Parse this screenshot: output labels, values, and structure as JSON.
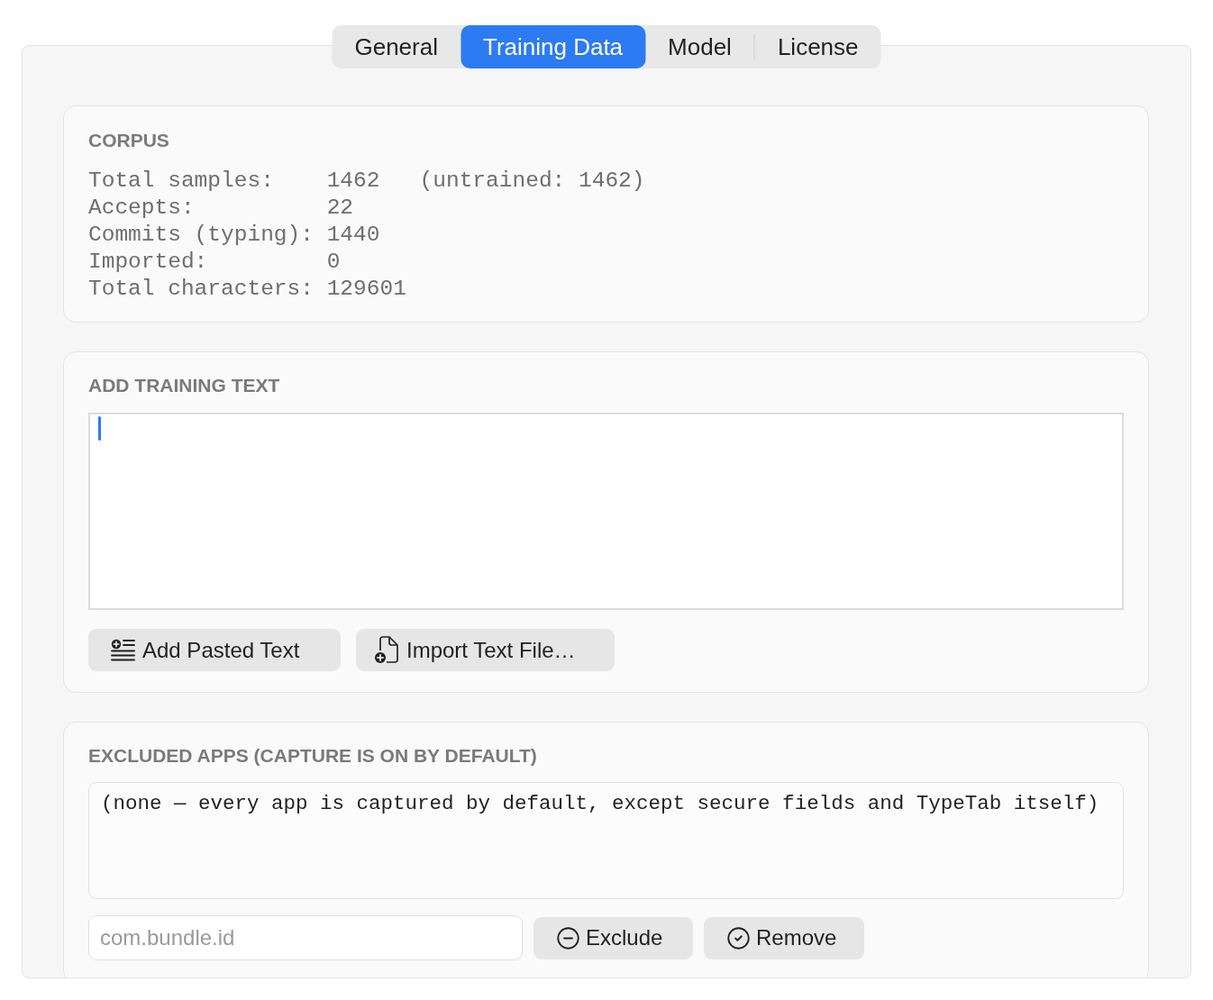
{
  "tabs": [
    {
      "label": "General",
      "selected": false
    },
    {
      "label": "Training Data",
      "selected": true
    },
    {
      "label": "Model",
      "selected": false
    },
    {
      "label": "License",
      "selected": false
    }
  ],
  "corpus": {
    "title": "CORPUS",
    "lines": [
      "Total samples:    1462   (untrained: 1462)",
      "Accepts:          22",
      "Commits (typing): 1440",
      "Imported:         0",
      "Total characters: 129601"
    ]
  },
  "add_training_text": {
    "title": "ADD TRAINING TEXT",
    "text_area": {
      "focused": true
    },
    "add_pasted_button": {
      "label": "Add Pasted Text"
    },
    "import_button": {
      "label": "Import Text File…"
    }
  },
  "excluded_apps": {
    "title": "EXCLUDED APPS (CAPTURE IS ON BY DEFAULT)",
    "empty_message": "(none — every app is captured by default, except secure fields and TypeTab itself)",
    "bundle_id_field": {
      "placeholder": "com.bundle.id"
    },
    "exclude_button": {
      "label": "Exclude"
    },
    "remove_button": {
      "label": "Remove"
    }
  }
}
